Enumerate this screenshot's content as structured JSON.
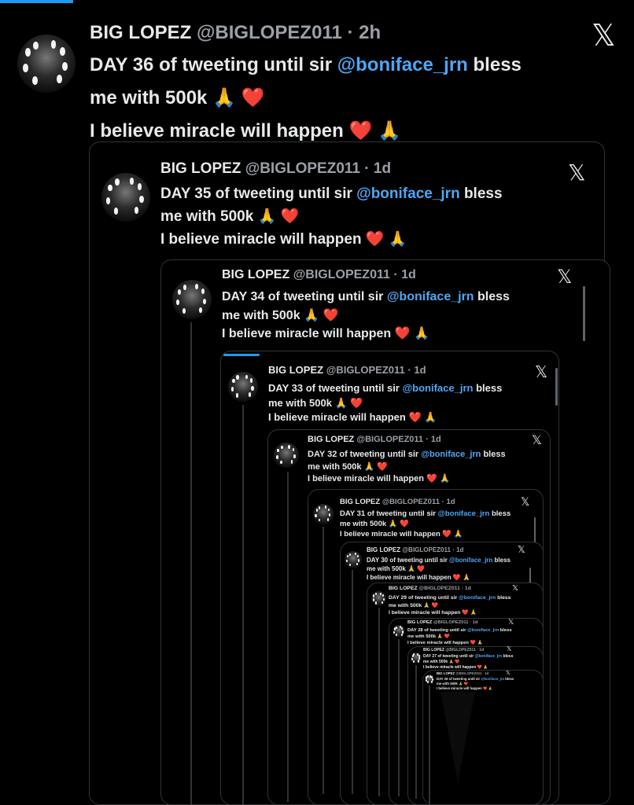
{
  "author": {
    "name": "BIG LOPEZ",
    "handle": "@BIGLOPEZ011"
  },
  "tweets": [
    {
      "time": "2h",
      "line1a": "DAY 36 of tweeting until sir ",
      "mention": "@boniface_jrn",
      "line1b": " bless",
      "line2": "me with 500k",
      "line3": "I believe miracle will happen"
    },
    {
      "time": "1d",
      "line1a": "DAY 35 of tweeting until sir ",
      "mention": "@boniface_jrn",
      "line1b": " bless",
      "line2": "me with 500k",
      "line3": "I believe miracle will happen"
    },
    {
      "time": "1d",
      "line1a": "DAY 34 of tweeting until sir ",
      "mention": "@boniface_jrn",
      "line1b": " bless",
      "line2": "me with 500k",
      "line3": "I believe miracle will happen"
    },
    {
      "time": "1d",
      "line1a": "DAY 33 of tweeting until sir ",
      "mention": "@boniface_jrn",
      "line1b": " bless",
      "line2": "me with 500k",
      "line3": "I believe miracle will happen"
    },
    {
      "time": "1d",
      "line1a": "DAY 32 of tweeting until sir ",
      "mention": "@boniface_jrn",
      "line1b": " bless",
      "line2": "me with 500k",
      "line3": "I believe miracle will happen"
    },
    {
      "time": "1d",
      "line1a": "DAY 31 of tweeting until sir ",
      "mention": "@boniface_jrn",
      "line1b": " bless",
      "line2": "me with 500k",
      "line3": "I believe miracle will happen"
    },
    {
      "time": "1d",
      "line1a": "DAY 30 of tweeting until sir ",
      "mention": "@boniface_jrn",
      "line1b": " bless",
      "line2": "me with 500k",
      "line3": "I believe miracle will happen"
    },
    {
      "time": "1d",
      "line1a": "DAY 29 of tweeting until sir ",
      "mention": "@boniface_jrn",
      "line1b": " bless",
      "line2": "me with 500k",
      "line3": "I believe miracle will happen"
    },
    {
      "time": "1d",
      "line1a": "DAY 28 of tweeting until sir ",
      "mention": "@boniface_jrn",
      "line1b": " bless",
      "line2": "me with 500k",
      "line3": "I believe miracle will happen"
    },
    {
      "time": "1d",
      "line1a": "DAY 27 of tweeting until sir ",
      "mention": "@boniface_jrn",
      "line1b": " bless",
      "line2": "me with 500k",
      "line3": "I believe miracle will happen"
    },
    {
      "time": "1d",
      "line1a": "DAY 26 of tweeting until sir ",
      "mention": "@boniface_jrn",
      "line1b": " bless",
      "line2": "me with 500k",
      "line3": "I believe miracle will happen"
    }
  ],
  "icons": {
    "x_logo": "𝕏",
    "pray": "🙏",
    "heart": "❤️"
  },
  "colors": {
    "background": "#000000",
    "mention": "#4ea6f5",
    "border": "#2f3336",
    "accent": "#1d9bf0"
  }
}
